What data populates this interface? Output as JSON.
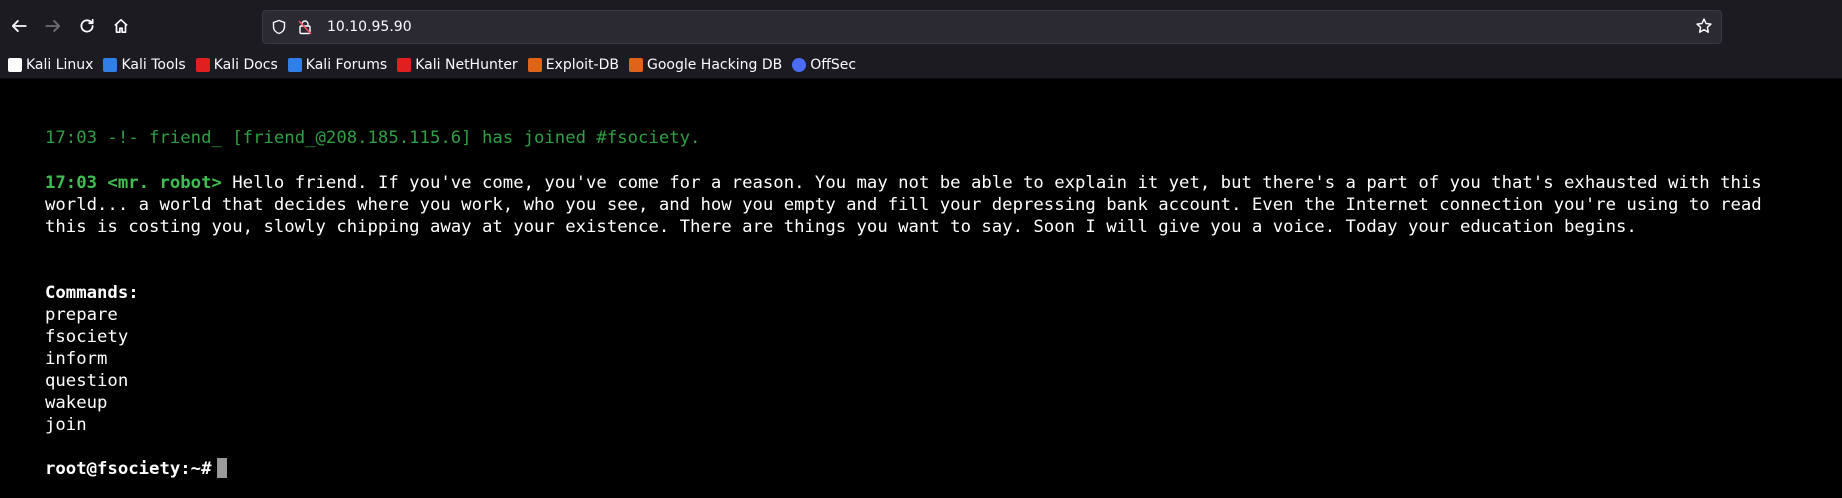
{
  "browser": {
    "url": "10.10.95.90",
    "bookmarks": [
      {
        "label": "Kali Linux",
        "color": "#ffffff"
      },
      {
        "label": "Kali Tools",
        "color": "#2f7fe6"
      },
      {
        "label": "Kali Docs",
        "color": "#e02020"
      },
      {
        "label": "Kali Forums",
        "color": "#2f7fe6"
      },
      {
        "label": "Kali NetHunter",
        "color": "#e02020"
      },
      {
        "label": "Exploit-DB",
        "color": "#e0631a"
      },
      {
        "label": "Google Hacking DB",
        "color": "#e0631a"
      },
      {
        "label": "OffSec",
        "color": "#4a6cf7"
      }
    ]
  },
  "terminal": {
    "join_line": "17:03 -!- friend_ [friend_@208.185.115.6] has joined #fsociety.",
    "msg_prefix": "17:03 <mr. robot>",
    "msg_line1": " Hello friend. If you've come, you've come for a reason. You may not be able to explain it yet, but there's a part of you that's exhausted with this",
    "msg_line2": "world... a world that decides where you work, who you see, and how you empty and fill your depressing bank account. Even the Internet connection you're using to read",
    "msg_line3": "this is costing you, slowly chipping away at your existence. There are things you want to say. Soon I will give you a voice. Today your education begins.",
    "commands_header": "Commands:",
    "commands": [
      "prepare",
      "fsociety",
      "inform",
      "question",
      "wakeup",
      "join"
    ],
    "prompt": "root@fsociety:~#"
  }
}
